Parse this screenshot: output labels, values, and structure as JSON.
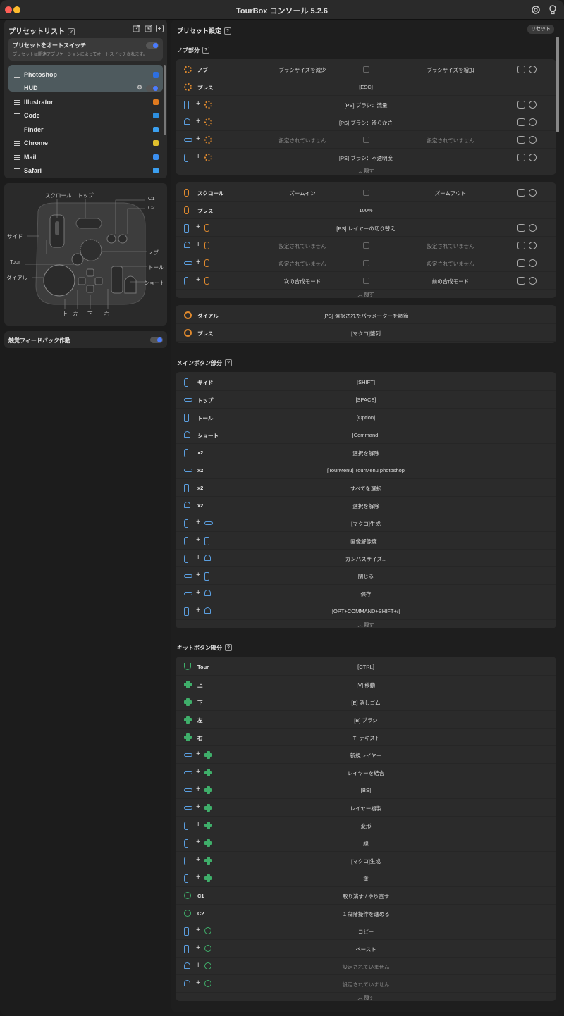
{
  "window": {
    "title": "TourBox コンソール 5.2.6"
  },
  "left": {
    "preset_list_title": "プリセットリスト",
    "auto_switch": {
      "title": "プリセットをオートスイッチ",
      "desc": "プリセットは関連アプリケーションによってオートスイッチされます。"
    },
    "apps": [
      {
        "name": "Photoshop",
        "color": "#2d6fe0"
      },
      {
        "name": "HUD",
        "color": ""
      },
      {
        "name": "Illustrator",
        "color": "#e07a1f"
      },
      {
        "name": "Code",
        "color": "#2d8fe0"
      },
      {
        "name": "Finder",
        "color": "#3ba0f0"
      },
      {
        "name": "Chrome",
        "color": "#e0c02d"
      },
      {
        "name": "Mail",
        "color": "#3b8ff0"
      },
      {
        "name": "Safari",
        "color": "#3b9ff0"
      }
    ],
    "device_labels": {
      "scroll": "スクロール",
      "top": "トップ",
      "c1": "C1",
      "c2": "C2",
      "side": "サイド",
      "knob": "ノブ",
      "tour": "Tour",
      "tall": "トール",
      "dial": "ダイアル",
      "short": "ショート",
      "up": "上",
      "left": "左",
      "down": "下",
      "right": "右"
    },
    "haptic": "触覚フィードバック作動"
  },
  "right": {
    "title": "プリセット設定",
    "reset": "リセット",
    "knob_section": "ノブ部分",
    "knob_rows": [
      {
        "icon": "knob",
        "label": "ノブ",
        "l": "ブラシサイズを減少",
        "r": "ブラシサイズを増加",
        "split": true
      },
      {
        "icon": "knob",
        "label": "プレス",
        "c": "[ESC]"
      },
      {
        "icon": "tall",
        "icon2": "knob",
        "c": "[PS] ブラシ：流量"
      },
      {
        "icon": "short",
        "icon2": "knob",
        "c": "[PS] ブラシ：滑らかさ"
      },
      {
        "icon": "top",
        "icon2": "knob",
        "l": "設定されていません",
        "r": "設定されていません",
        "split": true,
        "dim": true
      },
      {
        "icon": "side",
        "icon2": "knob",
        "c": "[PS] ブラシ：不透明度"
      }
    ],
    "scroll_rows": [
      {
        "icon": "scr",
        "label": "スクロール",
        "l": "ズームイン",
        "r": "ズームアウト",
        "split": true
      },
      {
        "icon": "scr",
        "label": "プレス",
        "c": "100%"
      },
      {
        "icon": "tall",
        "icon2": "scr",
        "c": "[PS] レイヤーの切り替え"
      },
      {
        "icon": "short",
        "icon2": "scr",
        "l": "設定されていません",
        "r": "設定されていません",
        "split": true,
        "dim": true
      },
      {
        "icon": "top",
        "icon2": "scr",
        "l": "設定されていません",
        "r": "設定されていません",
        "split": true,
        "dim": true
      },
      {
        "icon": "side",
        "icon2": "scr",
        "l": "次の合成モード",
        "r": "前の合成モード",
        "split": true
      }
    ],
    "dial_rows": [
      {
        "icon": "dial",
        "label": "ダイアル",
        "c": "[PS] 選択されたパラメーターを調節"
      },
      {
        "icon": "dial",
        "label": "プレス",
        "c": "[マクロ]整列"
      }
    ],
    "main_section": "メインボタン部分",
    "main_rows": [
      {
        "icon": "side",
        "label": "サイド",
        "c": "[SHIFT]"
      },
      {
        "icon": "top",
        "label": "トップ",
        "c": "[SPACE]"
      },
      {
        "icon": "tall",
        "label": "トール",
        "c": "[Option]"
      },
      {
        "icon": "short",
        "label": "ショート",
        "c": "[Command]"
      },
      {
        "icon": "side",
        "label": "x2",
        "c": "選択を解除"
      },
      {
        "icon": "top",
        "label": "x2",
        "c": "[TourMenu] TourMenu photoshop"
      },
      {
        "icon": "tall",
        "label": "x2",
        "c": "すべてを選択"
      },
      {
        "icon": "short",
        "label": "x2",
        "c": "選択を解除"
      },
      {
        "icon": "side",
        "icon2": "top",
        "c": "[マクロ]生成"
      },
      {
        "icon": "side",
        "icon2": "tall",
        "c": "画像解像度..."
      },
      {
        "icon": "side",
        "icon2": "short",
        "c": "カンバスサイズ..."
      },
      {
        "icon": "top",
        "icon2": "tall",
        "c": "閉じる"
      },
      {
        "icon": "top",
        "icon2": "short",
        "c": "保存"
      },
      {
        "icon": "tall",
        "icon2": "short",
        "c": "[OPT+COMMAND+SHIFT+/]"
      }
    ],
    "kit_section": "キットボタン部分",
    "kit_rows": [
      {
        "icon": "tour",
        "label": "Tour",
        "c": "[CTRL]"
      },
      {
        "icon": "dpad",
        "label": "上",
        "c": "[V] 移動"
      },
      {
        "icon": "dpad",
        "label": "下",
        "c": "[E] 消しゴム"
      },
      {
        "icon": "dpad",
        "label": "左",
        "c": "[B] ブラシ"
      },
      {
        "icon": "dpad",
        "label": "右",
        "c": "[T] テキスト"
      },
      {
        "icon": "top",
        "icon2": "dpad",
        "c": "新規レイヤー"
      },
      {
        "icon": "top",
        "icon2": "dpad",
        "c": "レイヤーを結合"
      },
      {
        "icon": "top",
        "icon2": "dpad",
        "c": "[BS]"
      },
      {
        "icon": "top",
        "icon2": "dpad",
        "c": "レイヤー複製"
      },
      {
        "icon": "side",
        "icon2": "dpad",
        "c": "変形"
      },
      {
        "icon": "side",
        "icon2": "dpad",
        "c": "線"
      },
      {
        "icon": "side",
        "icon2": "dpad",
        "c": "[マクロ]生成"
      },
      {
        "icon": "side",
        "icon2": "dpad",
        "c": "塗"
      },
      {
        "icon": "cbtn",
        "label": "C1",
        "c": "取り消す / やり直す"
      },
      {
        "icon": "cbtn",
        "label": "C2",
        "c": "１段階操作を進める"
      },
      {
        "icon": "tall",
        "icon2": "cbtn",
        "c": "コピー"
      },
      {
        "icon": "tall",
        "icon2": "cbtn",
        "c": "ペースト"
      },
      {
        "icon": "short",
        "icon2": "cbtn",
        "c": "設定されていません",
        "dim": true
      },
      {
        "icon": "short",
        "icon2": "cbtn",
        "c": "設定されていません",
        "dim": true
      }
    ],
    "hide": "隠す"
  }
}
